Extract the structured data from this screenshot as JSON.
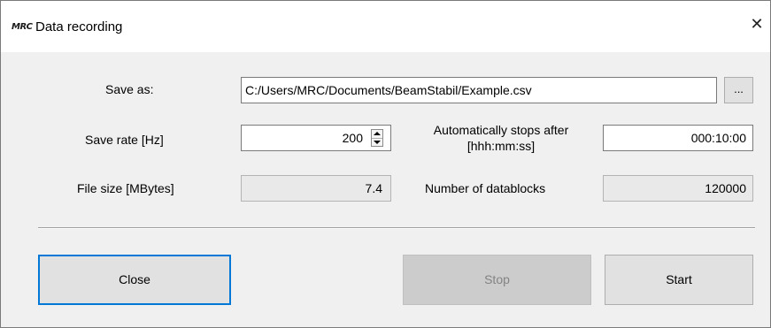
{
  "window": {
    "title": "Data recording",
    "logo_text": "MRC",
    "close_glyph": "✕",
    "icons": {
      "logo": "mrc-logo-icon",
      "close": "close-icon"
    }
  },
  "form": {
    "save_as": {
      "label": "Save as:",
      "value": "C:/Users/MRC/Documents/BeamStabil/Example.csv",
      "browse_label": "..."
    },
    "save_rate": {
      "label": "Save rate [Hz]",
      "value": "200"
    },
    "auto_stop": {
      "label_line1": "Automatically stops after",
      "label_line2": "[hhh:mm:ss]",
      "value": "000:10:00"
    },
    "file_size": {
      "label": "File size [MBytes]",
      "value": "7.4"
    },
    "datablocks": {
      "label": "Number of datablocks",
      "value": "120000"
    }
  },
  "buttons": {
    "close": "Close",
    "stop": "Stop",
    "start": "Start"
  },
  "colors": {
    "focus_border": "#0078d7",
    "disabled_bg": "#cccccc",
    "dialog_bg": "#f0f0f0"
  }
}
